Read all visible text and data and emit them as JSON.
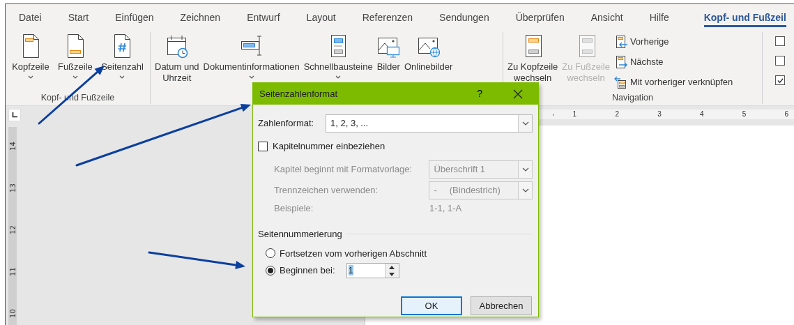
{
  "ribbon_tabs": [
    {
      "label": "Datei",
      "selected": false
    },
    {
      "label": "Start",
      "selected": false
    },
    {
      "label": "Einfügen",
      "selected": false
    },
    {
      "label": "Zeichnen",
      "selected": false
    },
    {
      "label": "Entwurf",
      "selected": false
    },
    {
      "label": "Layout",
      "selected": false
    },
    {
      "label": "Referenzen",
      "selected": false
    },
    {
      "label": "Sendungen",
      "selected": false
    },
    {
      "label": "Überprüfen",
      "selected": false
    },
    {
      "label": "Ansicht",
      "selected": false
    },
    {
      "label": "Hilfe",
      "selected": false
    },
    {
      "label": "Kopf- und Fußzeil",
      "selected": true
    }
  ],
  "ribbon_groups": [
    {
      "label": "Kopf- und Fußzeile",
      "buttons": [
        {
          "kind": "large",
          "lines": [
            "Kopfzeile"
          ],
          "dropdown": true,
          "disabled": false
        },
        {
          "kind": "large",
          "lines": [
            "Fußzeile"
          ],
          "dropdown": true,
          "disabled": false
        },
        {
          "kind": "large",
          "lines": [
            "Seitenzahl"
          ],
          "dropdown": true,
          "disabled": false
        }
      ]
    },
    {
      "buttons": [
        {
          "kind": "large",
          "lines": [
            "Datum und",
            "Uhrzeit"
          ],
          "dropdown": false,
          "disabled": false
        },
        {
          "kind": "large",
          "lines": [
            "Dokumentinformationen"
          ],
          "dropdown": true,
          "disabled": false
        },
        {
          "kind": "large",
          "lines": [
            "Schnellbausteine"
          ],
          "dropdown": true,
          "disabled": false
        },
        {
          "kind": "large",
          "lines": [
            "Bilder"
          ],
          "dropdown": false,
          "disabled": false
        },
        {
          "kind": "large",
          "lines": [
            "Onlinebilder"
          ],
          "dropdown": false,
          "disabled": false
        }
      ]
    },
    {
      "label": "Navigation",
      "buttons": [
        {
          "kind": "large",
          "lines": [
            "Zu Kopfzeile",
            "wechseln"
          ],
          "dropdown": false,
          "disabled": false
        },
        {
          "kind": "large",
          "lines": [
            "Zu Fußzeile",
            "wechseln"
          ],
          "dropdown": false,
          "disabled": true
        },
        {
          "kind": "small",
          "lines": [
            "Vorherige"
          ],
          "dropdown": false,
          "disabled": false
        },
        {
          "kind": "small",
          "lines": [
            "Nächste"
          ],
          "dropdown": false,
          "disabled": false
        },
        {
          "kind": "small",
          "lines": [
            "Mit vorheriger verknüpfen"
          ],
          "dropdown": false,
          "disabled": false
        }
      ]
    },
    {
      "options": [
        {
          "checked": false
        },
        {
          "checked": false
        },
        {
          "checked": true
        }
      ]
    }
  ],
  "rulers": {
    "vertical": [
      "14",
      "13",
      "12",
      "11",
      "10"
    ],
    "horizontal": [
      "1",
      "2",
      "3",
      "4",
      "5",
      "6"
    ]
  },
  "dialog": {
    "title": "Seitenzahlenformat",
    "help": "?",
    "number_format": {
      "label": "Zahlenformat:",
      "value": "1, 2, 3, ..."
    },
    "include_chapter": {
      "label": "Kapitelnummer einbeziehen",
      "checked": false
    },
    "chapter_fields": [
      {
        "kind": "dropdown",
        "label": "Kapitel beginnt mit Formatvorlage:",
        "value": "Überschrift 1",
        "disabled": true
      },
      {
        "kind": "dropdown",
        "label": "Trennzeichen verwenden:",
        "value": "-     (Bindestrich)",
        "disabled": true
      },
      {
        "kind": "text",
        "label": "Beispiele:",
        "value": "1-1, 1-A",
        "disabled": true
      }
    ],
    "numbering": {
      "title": "Seitennummerierung",
      "options": [
        {
          "label": "Fortsetzen vom vorherigen Abschnitt",
          "selected": false
        },
        {
          "label": "Beginnen bei:",
          "selected": true
        }
      ],
      "start_at": "1"
    },
    "buttons": [
      {
        "label": "OK",
        "default": true
      },
      {
        "label": "Abbrechen",
        "default": false
      }
    ]
  }
}
